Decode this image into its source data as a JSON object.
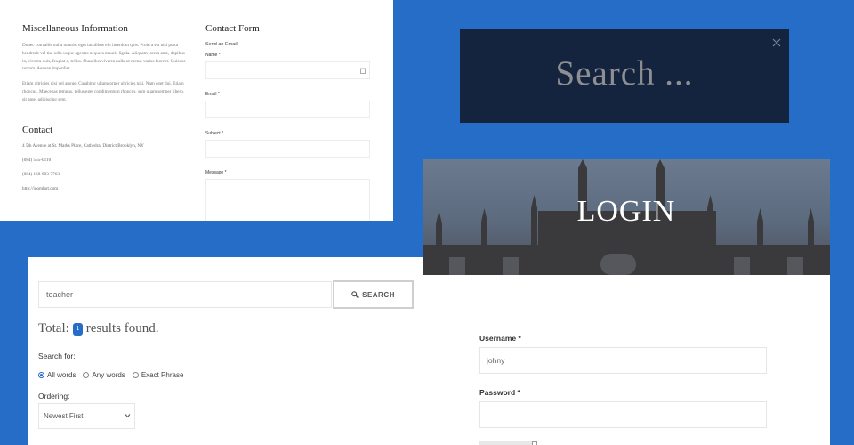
{
  "info": {
    "misc_title": "Miscellaneous Information",
    "misc_p1": "Donec convallis nulla mauris, eget iaculibus elit interdum quis. Proin a est nisi porta hendrerit vel tiat odio usque egestas neque a mauris ligula. Aliquam lorem ante, dapibus in, viverra quis, feugiat a, tellus. Phasellus viverra nulla ut metus varius laoreet. Quisque rutrum. Aenean imperdiet.",
    "misc_p2": "Etiam ultricies nisi vel augue. Curabitur ullamcorper ultricies nisi. Nam eget dui. Etiam rhoncus. Maecenas tempus, tellus eget condimentum rhoncus, sem quam semper libero, sit amet adipiscing sem.",
    "contact_title": "Contact",
    "address": "4 5th Avenue at St. Marks Place, Cathedral District Brooklyn, NY",
    "phone1": "(084) 555-0110",
    "phone2": "(084) 168-993-7763",
    "website": "http://joomlart.com"
  },
  "contact_form": {
    "title": "Contact Form",
    "subtitle": "Send an Email",
    "name_label": "Name *",
    "email_label": "Email *",
    "subject_label": "Subject *",
    "message_label": "Message *"
  },
  "search_overlay": {
    "placeholder": "Search ..."
  },
  "results": {
    "query": "teacher",
    "button_label": "SEARCH",
    "total_prefix": "Total:",
    "total_count": "1",
    "total_suffix": "results found.",
    "search_for_label": "Search for:",
    "options": [
      "All words",
      "Any words",
      "Exact Phrase"
    ],
    "selected_option": "All words",
    "ordering_label": "Ordering:",
    "ordering_value": "Newest First"
  },
  "login": {
    "title": "LOGIN",
    "username_label": "Username *",
    "username_value": "johny",
    "password_label": "Password *",
    "password_value": ""
  },
  "colors": {
    "background": "#256dc6",
    "overlay": "#15243e",
    "accent": "#256dc6"
  }
}
